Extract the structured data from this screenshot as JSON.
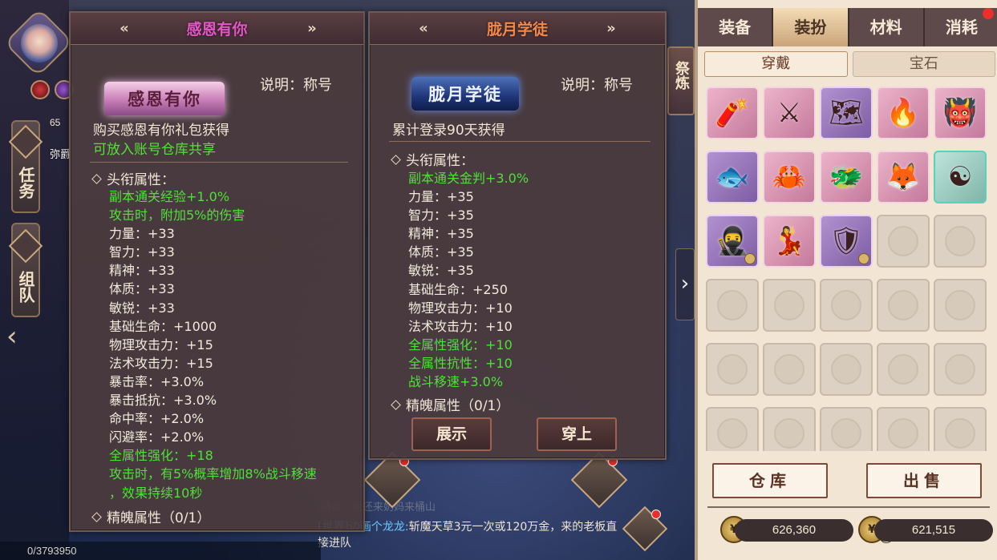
{
  "hud": {
    "level": "65",
    "name": "弥爵",
    "side_tabs": [
      "任务",
      "组队"
    ],
    "status": "0/3793950"
  },
  "chat": {
    "faded_line": "猜疑：我还来奶妈来桶山",
    "sender": "[世界]边画个龙龙:",
    "message": "斩魔天草3元一次或120万金，来的老板直接进队"
  },
  "refine_tab": "祭炼",
  "left_panel": {
    "header_title": "感恩有你",
    "banner_text": "感恩有你",
    "desc_label": "说明：称号",
    "obtain": "购买感恩有你礼包获得",
    "share": "可放入账号仓库共享",
    "section_title": "头衔属性：",
    "attributes": [
      {
        "text": "副本通关经验+1.0%",
        "color": "green"
      },
      {
        "text": "攻击时，附加5%的伤害",
        "color": "green"
      },
      {
        "text": "力量：+33",
        "color": "white"
      },
      {
        "text": "智力：+33",
        "color": "white"
      },
      {
        "text": "精神：+33",
        "color": "white"
      },
      {
        "text": "体质：+33",
        "color": "white"
      },
      {
        "text": "敏锐：+33",
        "color": "white"
      },
      {
        "text": "基础生命：+1000",
        "color": "white"
      },
      {
        "text": "物理攻击力：+15",
        "color": "white"
      },
      {
        "text": "法术攻击力：+15",
        "color": "white"
      },
      {
        "text": "暴击率：+3.0%",
        "color": "white"
      },
      {
        "text": "暴击抵抗：+3.0%",
        "color": "white"
      },
      {
        "text": "命中率：+2.0%",
        "color": "white"
      },
      {
        "text": "闪避率：+2.0%",
        "color": "white"
      },
      {
        "text": "全属性强化：+18",
        "color": "green"
      },
      {
        "text": "攻击时，有5%概率增加8%战斗移速",
        "color": "green"
      },
      {
        "text": "，效果持续10秒",
        "color": "green"
      }
    ],
    "soul_title": "精魄属性（0/1）"
  },
  "right_panel": {
    "header_title": "胧月学徒",
    "banner_text": "胧月学徒",
    "desc_label": "说明：称号",
    "obtain": "累计登录90天获得",
    "section_title": "头衔属性：",
    "attributes": [
      {
        "text": "副本通关金判+3.0%",
        "color": "green"
      },
      {
        "text": "力量：+35",
        "color": "white"
      },
      {
        "text": "智力：+35",
        "color": "white"
      },
      {
        "text": "精神：+35",
        "color": "white"
      },
      {
        "text": "体质：+35",
        "color": "white"
      },
      {
        "text": "敏锐：+35",
        "color": "white"
      },
      {
        "text": "基础生命：+250",
        "color": "white"
      },
      {
        "text": "物理攻击力：+10",
        "color": "white"
      },
      {
        "text": "法术攻击力：+10",
        "color": "white"
      },
      {
        "text": "全属性强化：+10",
        "color": "green"
      },
      {
        "text": "全属性抗性：+10",
        "color": "green"
      },
      {
        "text": "战斗移速+3.0%",
        "color": "green"
      }
    ],
    "soul_title": "精魄属性（0/1）",
    "show_button": "展示",
    "wear_button": "穿上"
  },
  "bag": {
    "tabs": [
      "装备",
      "装扮",
      "材料",
      "消耗"
    ],
    "active_tab": "装扮",
    "sub_tabs": [
      "穿戴",
      "宝石"
    ],
    "active_sub_tab": "穿戴",
    "items": [
      {
        "icon": "firecracker-icon",
        "glyph": "🧨",
        "style": "pink"
      },
      {
        "icon": "sword-icon",
        "glyph": "⚔",
        "style": "pink"
      },
      {
        "icon": "scroll-map-icon",
        "glyph": "🗺",
        "style": "purple"
      },
      {
        "icon": "flame-mask-icon",
        "glyph": "🔥",
        "style": "pink"
      },
      {
        "icon": "oni-mask-icon",
        "glyph": "👹",
        "style": "pink"
      },
      {
        "icon": "fish-icon",
        "glyph": "🐟",
        "style": "purple"
      },
      {
        "icon": "claw-icon",
        "glyph": "🦀",
        "style": "pink"
      },
      {
        "icon": "beast-icon",
        "glyph": "🐲",
        "style": "pink"
      },
      {
        "icon": "fox-spirit-icon",
        "glyph": "🦊",
        "style": "pink"
      },
      {
        "icon": "yin-orb-icon",
        "glyph": "☯",
        "style": "teal"
      },
      {
        "icon": "warrior-costume-icon",
        "glyph": "🥷",
        "style": "purple",
        "locked": true
      },
      {
        "icon": "dancer-costume-icon",
        "glyph": "💃",
        "style": "pink"
      },
      {
        "icon": "armor-costume-icon",
        "glyph": "🛡",
        "style": "purple",
        "locked": true
      }
    ],
    "empty_slots": 17,
    "warehouse_button": "仓库",
    "sell_button": "出售",
    "coins_left": "626,360",
    "coins_right": "621,515"
  }
}
